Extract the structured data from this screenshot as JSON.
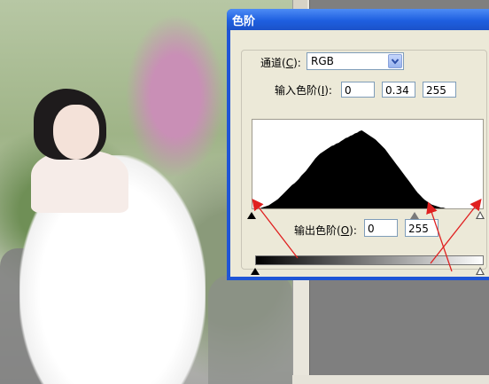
{
  "dialog": {
    "title": "色阶",
    "channel": {
      "label_pre": "通道(",
      "key": "C",
      "label_post": "):",
      "value": "RGB"
    },
    "input_levels": {
      "label_pre": "输入色阶(",
      "key": "I",
      "label_post": "):",
      "black": "0",
      "gamma": "0.34",
      "white": "255"
    },
    "output_levels": {
      "label_pre": "输出色阶(",
      "key": "O",
      "label_post": "):",
      "black": "0",
      "white": "255"
    }
  },
  "sliders": {
    "input_black": 0,
    "input_gray": 0.715,
    "input_white": 1.0,
    "output_black": 0,
    "output_white": 1.0
  },
  "histogram": {
    "profile": [
      0,
      0,
      0,
      0,
      1,
      2,
      3,
      4,
      6,
      8,
      10,
      12,
      15,
      18,
      21,
      24,
      27,
      30,
      32,
      35,
      38,
      42,
      45,
      48,
      52,
      56,
      60,
      64,
      67,
      70,
      72,
      74,
      76,
      78,
      80,
      81,
      83,
      84,
      86,
      88,
      90,
      91,
      93,
      94,
      96,
      97,
      99,
      100,
      98,
      96,
      94,
      92,
      90,
      88,
      85,
      82,
      79,
      76,
      72,
      68,
      64,
      60,
      56,
      52,
      48,
      44,
      40,
      36,
      32,
      28,
      24,
      20,
      17,
      14,
      11,
      9,
      7,
      5,
      4,
      3,
      2,
      1,
      1,
      0,
      0,
      0,
      0,
      0,
      0,
      0,
      0,
      0,
      0,
      0,
      0,
      0,
      0,
      0,
      0,
      0
    ]
  },
  "colors": {
    "titlebar": "#1e5fe0",
    "client": "#ece9d8",
    "annotation": "#e02020"
  }
}
